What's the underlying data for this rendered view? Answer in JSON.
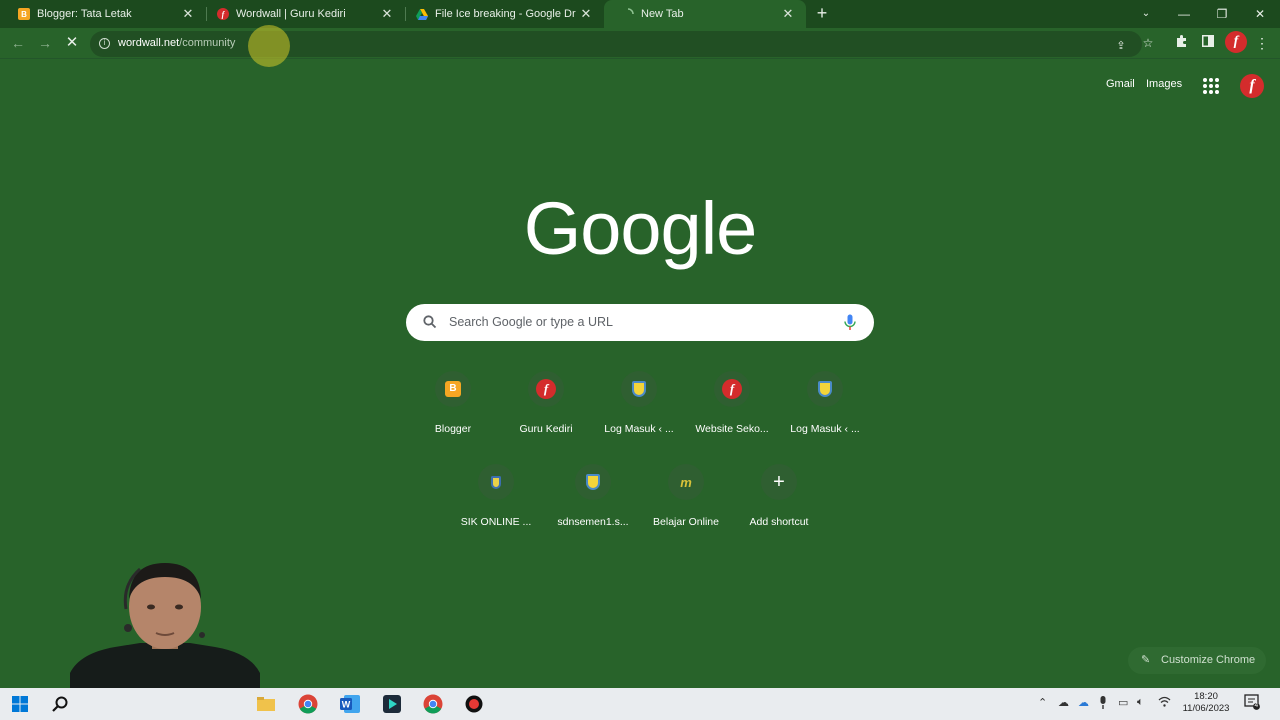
{
  "tabs": [
    {
      "title": "Blogger: Tata Letak",
      "favicon": "blogger-icon",
      "active": false
    },
    {
      "title": "Wordwall | Guru Kediri",
      "favicon": "wordwall-icon",
      "active": false
    },
    {
      "title": "File Ice breaking - Google Drive",
      "favicon": "google-drive-icon",
      "active": false
    },
    {
      "title": "New Tab",
      "favicon": "loading-spinner-icon",
      "active": true
    }
  ],
  "toolbar": {
    "url_host": "wordwall.net",
    "url_path": "/community",
    "loading": true
  },
  "ntp": {
    "gmail_link": "Gmail",
    "images_link": "Images",
    "logo": "Google",
    "search_placeholder": "Search Google or type a URL",
    "shortcuts_row1": [
      {
        "label": "Blogger",
        "icon": "blogger-icon"
      },
      {
        "label": "Guru Kediri",
        "icon": "wordwall-icon"
      },
      {
        "label": "Log Masuk ‹ ...",
        "icon": "school-shield-icon"
      },
      {
        "label": "Website Seko...",
        "icon": "wordwall-icon"
      },
      {
        "label": "Log Masuk ‹ ...",
        "icon": "school-shield-icon"
      }
    ],
    "shortcuts_row2": [
      {
        "label": "SIK ONLINE ...",
        "icon": "school-shield-icon"
      },
      {
        "label": "sdnsemen1.s...",
        "icon": "school-shield-icon"
      },
      {
        "label": "Belajar Online",
        "icon": "m-logo-icon"
      },
      {
        "label": "Add shortcut",
        "icon": "plus-icon"
      }
    ],
    "customize_label": "Customize Chrome"
  },
  "taskbar": {
    "time": "18:20",
    "date": "11/06/2023",
    "notifications": "4"
  },
  "colors": {
    "theme_green": "#28632a",
    "tabstrip_green": "#1c4a1e",
    "wordwall_red": "#d42c2c"
  }
}
